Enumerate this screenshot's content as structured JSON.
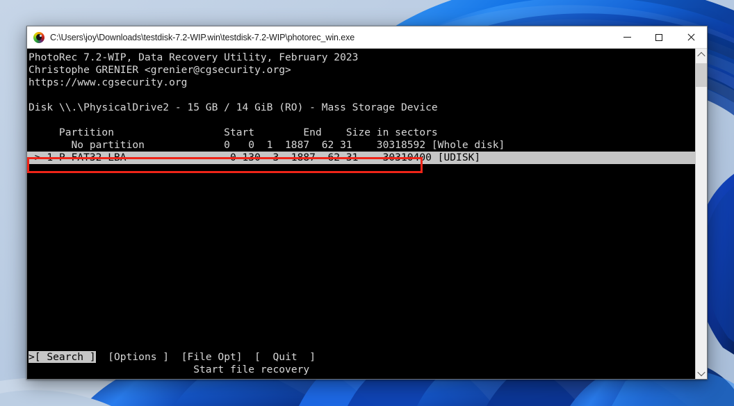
{
  "window": {
    "title": "C:\\Users\\joy\\Downloads\\testdisk-7.2-WIP.win\\testdisk-7.2-WIP\\photorec_win.exe",
    "icon": "photorec-eye-icon",
    "controls": {
      "minimize": "minimize-button",
      "maximize": "maximize-button",
      "close": "close-button"
    }
  },
  "console": {
    "header": [
      "PhotoRec 7.2-WIP, Data Recovery Utility, February 2023",
      "Christophe GRENIER <grenier@cgsecurity.org>",
      "https://www.cgsecurity.org",
      "",
      "Disk \\\\.\\PhysicalDrive2 - 15 GB / 14 GiB (RO) - Mass Storage Device"
    ],
    "table_header": "     Partition                  Start        End    Size in sectors",
    "rows": [
      {
        "text": "       No partition             0   0  1  1887  62 31    30318592 [Whole disk]",
        "selected": false
      },
      {
        "text": " > 1 P FAT32 LBA                 0 130  3  1887  62 31    30310400 [UDISK]",
        "selected": true
      }
    ],
    "highlight_box_color": "#ef2418"
  },
  "menu": {
    "items": [
      {
        "label": ">[ Search ]",
        "selected": true
      },
      {
        "label": "[Options ]",
        "selected": false
      },
      {
        "label": "[File Opt]",
        "selected": false
      },
      {
        "label": "[  Quit  ]",
        "selected": false
      }
    ],
    "hint": "Start file recovery",
    "hint_indent": "                           "
  },
  "scrollbar": {
    "up_arrow": "scroll-up-icon",
    "down_arrow": "scroll-down-icon"
  }
}
